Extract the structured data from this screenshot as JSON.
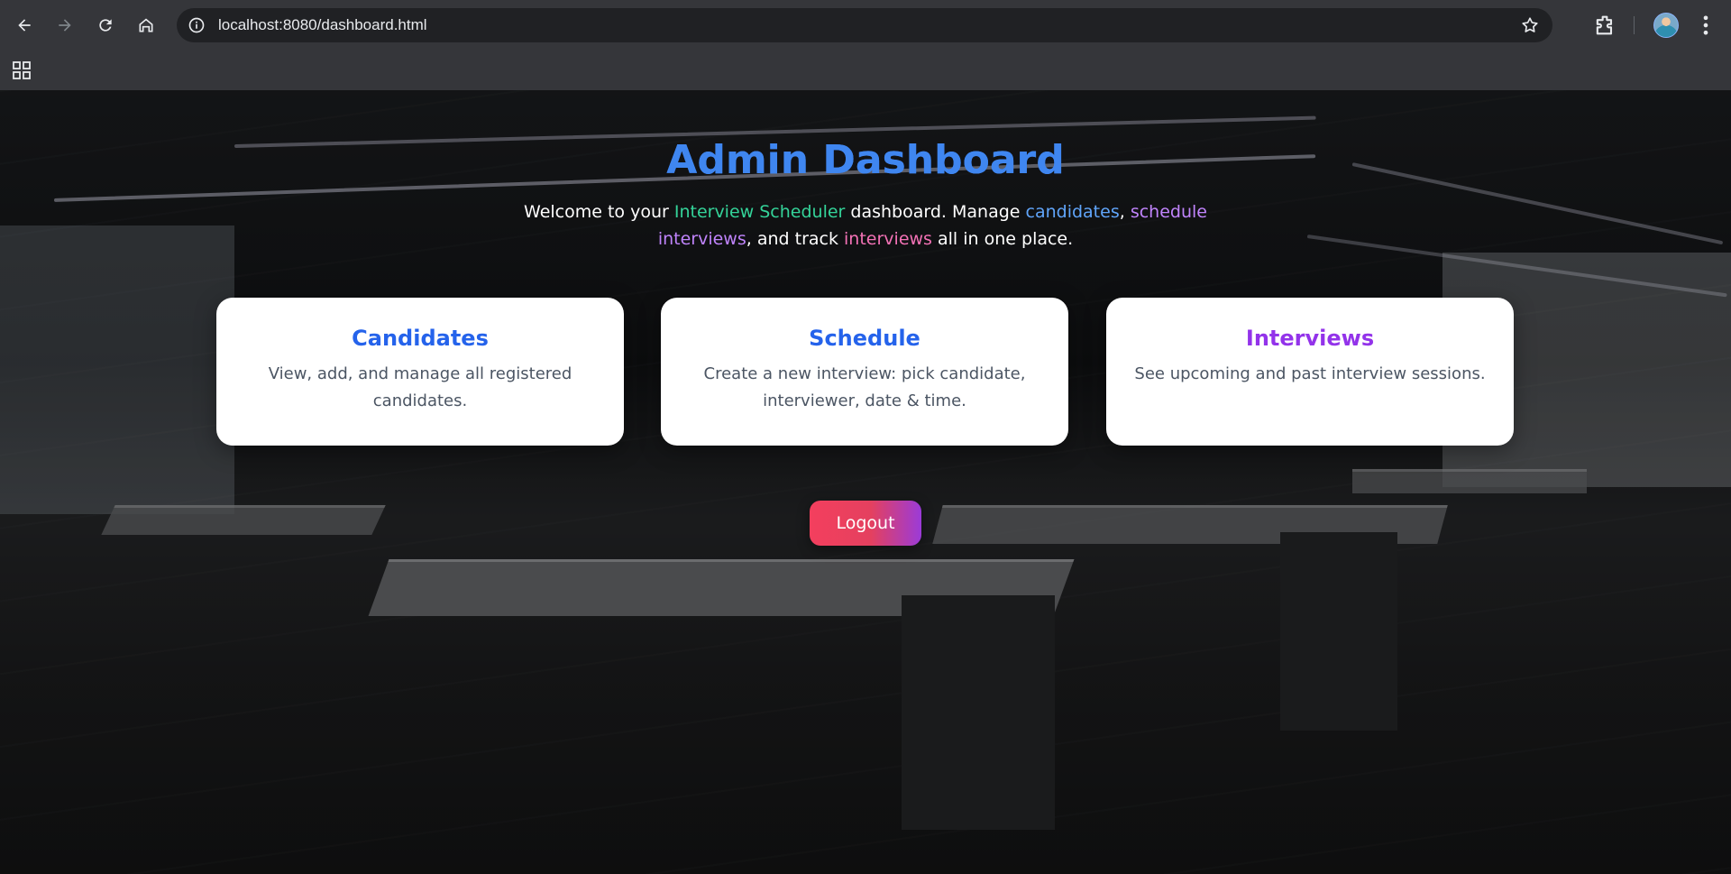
{
  "browser": {
    "url": "localhost:8080/dashboard.html",
    "icons": {
      "back": "arrow-left-icon",
      "forward": "arrow-right-icon",
      "reload": "reload-icon",
      "home": "home-icon",
      "site_info": "info-icon",
      "bookmark": "star-icon",
      "extensions": "puzzle-icon",
      "profile": "avatar",
      "menu": "kebab-menu-icon",
      "apps": "apps-grid-icon"
    }
  },
  "dashboard": {
    "title": "Admin Dashboard",
    "intro": {
      "part1": "Welcome to your ",
      "app_name": "Interview Scheduler",
      "part2": " dashboard. Manage ",
      "candidates": "candidates",
      "comma": ", ",
      "schedule": "schedule interviews",
      "part3": ", and track ",
      "interviews": "interviews",
      "part4": " all in one place."
    },
    "cards": [
      {
        "title": "Candidates",
        "description": "View, add, and manage all registered candidates."
      },
      {
        "title": "Schedule",
        "description": "Create a new interview: pick candidate, interviewer, date & time."
      },
      {
        "title": "Interviews",
        "description": "See upcoming and past interview sessions."
      }
    ],
    "logout_label": "Logout"
  },
  "colors": {
    "title": "#3b82f6",
    "highlight_green": "#34d399",
    "highlight_blue": "#60a5fa",
    "highlight_purple": "#c084fc",
    "highlight_pink": "#f472b6",
    "card_title_blue": "#2563eb",
    "card_title_purple": "#9333ea",
    "logout_gradient_start": "#f43f5e",
    "logout_gradient_end": "#9b3bd8"
  }
}
